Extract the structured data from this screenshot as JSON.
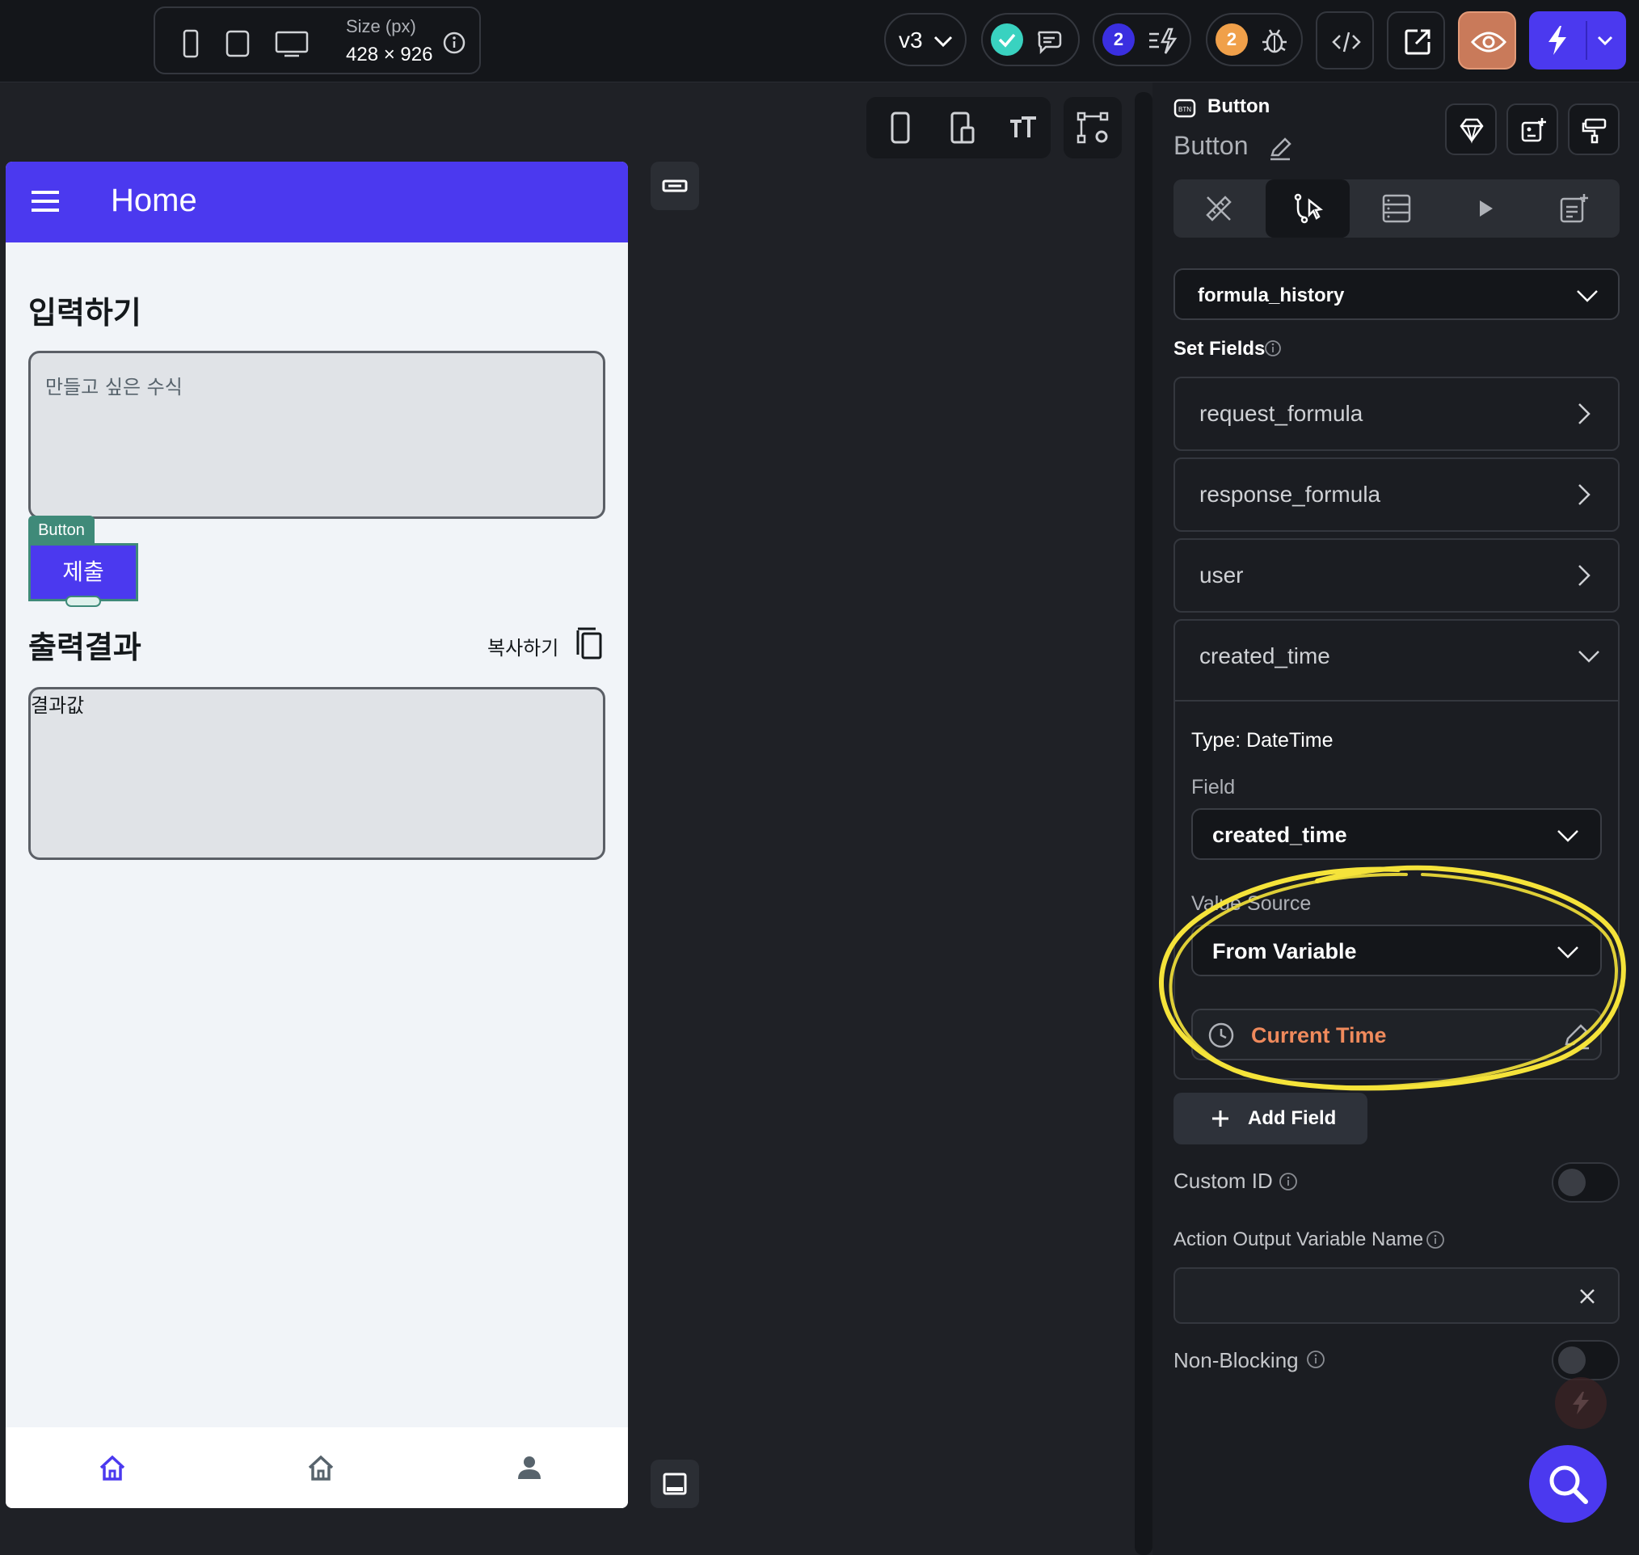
{
  "topbar": {
    "size_label": "Size (px)",
    "size_value": "428 × 926",
    "version": "v3",
    "issues_count": "2",
    "warnings_count": "2",
    "device_icons": [
      "phone-icon",
      "tablet-icon",
      "desktop-icon"
    ]
  },
  "app": {
    "appbar_title": "Home",
    "input_heading": "입력하기",
    "input_placeholder": "만들고 싶은 수식",
    "selected_widget_tag": "Button",
    "submit_label": "제출",
    "output_heading": "출력결과",
    "copy_label": "복사하기",
    "output_placeholder": "결과값",
    "nav_items": [
      "home-icon",
      "home-outline-icon",
      "person-icon"
    ]
  },
  "panel": {
    "widget_type": "Button",
    "widget_name": "Button",
    "collection": "formula_history",
    "set_fields_label": "Set Fields",
    "fields": [
      "request_formula",
      "response_formula",
      "user",
      "created_time"
    ],
    "expanded_field": {
      "type_label": "Type: DateTime",
      "field_label": "Field",
      "field_value": "created_time",
      "value_source_label": "Value Source",
      "value_source": "From Variable",
      "variable_value": "Current Time"
    },
    "add_field_label": "Add Field",
    "custom_id_label": "Custom ID",
    "output_var_label": "Action Output Variable Name",
    "non_blocking_label": "Non-Blocking"
  },
  "colors": {
    "primary": "#4b39ef",
    "selection": "#3f8a79",
    "variable_orange": "#ef8a5c",
    "annotation_yellow": "#f5e33a",
    "issues_badge": "#3a2fe0",
    "warnings_badge": "#f0a04a",
    "success": "#39d2c0"
  }
}
